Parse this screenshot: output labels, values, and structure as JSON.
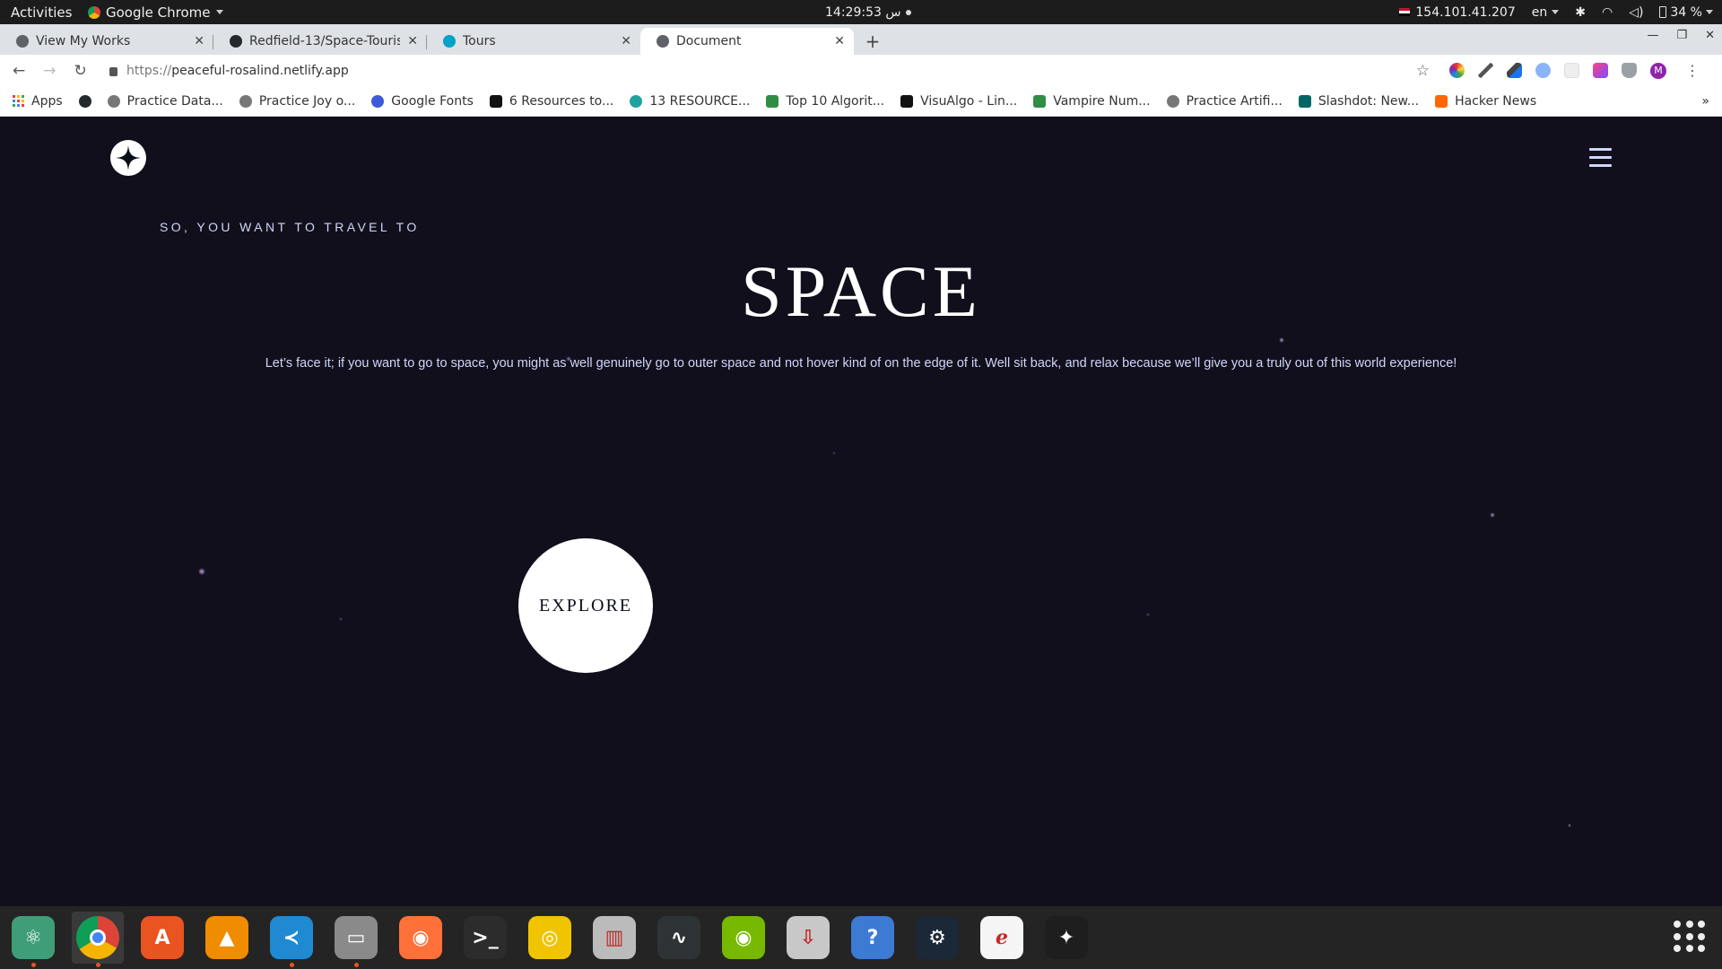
{
  "topbar": {
    "activities": "Activities",
    "app_name": "Google Chrome",
    "clock": "14:29:53 س",
    "ip": "154.101.41.207",
    "lang": "en",
    "battery": "34 %"
  },
  "tabs": [
    {
      "title": "View My Works",
      "favicon_color": "#5f6368"
    },
    {
      "title": "Redfield-13/Space-Tourism",
      "favicon_color": "#24292e"
    },
    {
      "title": "Tours",
      "favicon_color": "#00a2c7"
    },
    {
      "title": "Document",
      "favicon_color": "#5f6368"
    }
  ],
  "active_tab_index": 3,
  "address_bar": {
    "url_prefix": "https://",
    "url_host": "peaceful-rosalind.netlify.app"
  },
  "bookmarks": [
    {
      "label": "Apps",
      "color": "#e8453c"
    },
    {
      "label": "",
      "color": "#24292e"
    },
    {
      "label": "Practice Data...",
      "color": "#777777"
    },
    {
      "label": "Practice Joy o...",
      "color": "#777777"
    },
    {
      "label": "Google Fonts",
      "color": "#3c5bd8"
    },
    {
      "label": "6 Resources to...",
      "color": "#111111"
    },
    {
      "label": "13 RESOURCE...",
      "color": "#20a39e"
    },
    {
      "label": "Top 10 Algorit...",
      "color": "#2f8d46"
    },
    {
      "label": "VisuAlgo - Lin...",
      "color": "#111111"
    },
    {
      "label": "Vampire Num...",
      "color": "#2f8d46"
    },
    {
      "label": "Practice Artifi...",
      "color": "#777777"
    },
    {
      "label": "Slashdot: New...",
      "color": "#026664"
    },
    {
      "label": "Hacker News",
      "color": "#ff6600"
    }
  ],
  "bookmarks_overflow": "»",
  "page": {
    "subtitle": "SO, YOU WANT TO TRAVEL TO",
    "title": "SPACE",
    "description": "Let’s face it; if you want to go to space, you might as well genuinely go to outer space and not hover kind of on the edge of it. Well sit back, and relax because we’ll give you a truly out of this world experience!",
    "cta": "EXPLORE",
    "colors": {
      "background": "#120f1c",
      "text": "#d0d6f9",
      "white": "#ffffff"
    }
  },
  "dock": [
    {
      "name": "atom",
      "color": "#3f9e78",
      "glyph": "⚛",
      "running": true
    },
    {
      "name": "chrome",
      "color": "#dddddd",
      "glyph": "",
      "running": true,
      "active": true
    },
    {
      "name": "software-center",
      "color": "#e95420",
      "glyph": "A",
      "running": false
    },
    {
      "name": "vlc",
      "color": "#f08c00",
      "glyph": "▲",
      "running": false
    },
    {
      "name": "vscode",
      "color": "#1f8ad2",
      "glyph": "≺",
      "running": true
    },
    {
      "name": "file-manager",
      "color": "#8a8a8a",
      "glyph": "▭",
      "running": true
    },
    {
      "name": "firefox",
      "color": "#ff7139",
      "glyph": "◉",
      "running": false
    },
    {
      "name": "terminal",
      "color": "#2c2c2c",
      "glyph": ">_",
      "running": false
    },
    {
      "name": "rhythmbox",
      "color": "#f0c400",
      "glyph": "◎",
      "running": false
    },
    {
      "name": "settings-tool",
      "color": "#bbbbbb",
      "glyph": "▥",
      "running": false
    },
    {
      "name": "system-monitor",
      "color": "#2e3436",
      "glyph": "∿",
      "running": false
    },
    {
      "name": "nvidia",
      "color": "#76b900",
      "glyph": "◉",
      "running": false
    },
    {
      "name": "installer",
      "color": "#c8c8c8",
      "glyph": "⇩",
      "running": false
    },
    {
      "name": "help",
      "color": "#3c7ad4",
      "glyph": "?",
      "running": false
    },
    {
      "name": "steam",
      "color": "#1b2838",
      "glyph": "⚙",
      "running": false
    },
    {
      "name": "pdf-reader",
      "color": "#f5f5f5",
      "glyph": "ℯ",
      "running": false
    },
    {
      "name": "figma",
      "color": "#1e1e1e",
      "glyph": "✦",
      "running": false
    }
  ]
}
